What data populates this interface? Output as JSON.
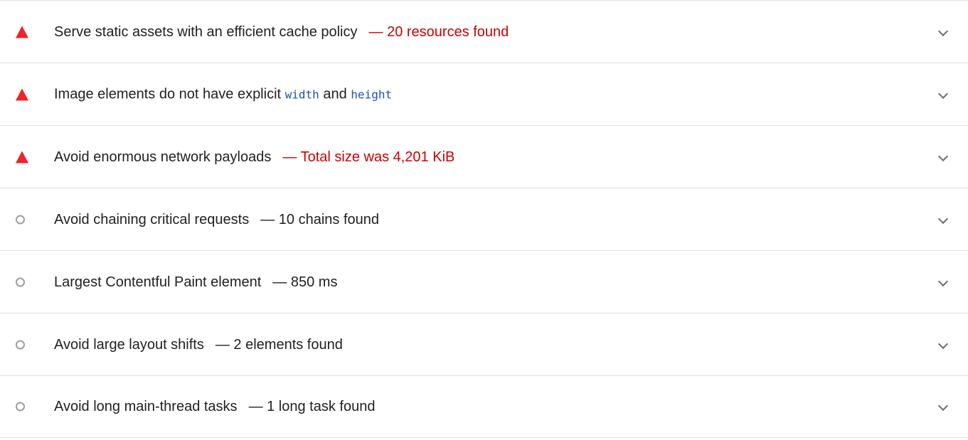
{
  "audits": [
    {
      "status": "fail",
      "title": "Serve static assets with an efficient cache policy",
      "display": "— 20 resources found"
    },
    {
      "status": "fail",
      "title_parts": [
        "Image elements do not have explicit ",
        "width",
        " and ",
        "height"
      ],
      "display": ""
    },
    {
      "status": "fail",
      "title": "Avoid enormous network payloads",
      "display": "— Total size was 4,201 KiB"
    },
    {
      "status": "info",
      "title": "Avoid chaining critical requests",
      "display": "— 10 chains found"
    },
    {
      "status": "info",
      "title": "Largest Contentful Paint element",
      "display": "— 850 ms"
    },
    {
      "status": "info",
      "title": "Avoid large layout shifts",
      "display": "— 2 elements found"
    },
    {
      "status": "info",
      "title": "Avoid long main-thread tasks",
      "display": "— 1 long task found"
    }
  ],
  "colors": {
    "fail": "#f0222b",
    "fail_text": "#cc0000",
    "info": "#9e9e9e",
    "code": "#1a4fc2",
    "divider": "#e0e0e0"
  }
}
